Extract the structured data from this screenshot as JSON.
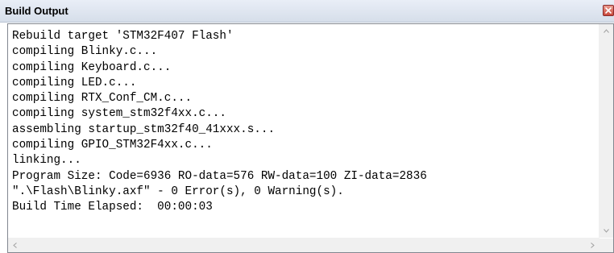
{
  "window": {
    "title": "Build Output",
    "close_icon": "close-icon"
  },
  "log": {
    "lines": [
      "Rebuild target 'STM32F407 Flash'",
      "compiling Blinky.c...",
      "compiling Keyboard.c...",
      "compiling LED.c...",
      "compiling RTX_Conf_CM.c...",
      "compiling system_stm32f4xx.c...",
      "assembling startup_stm32f40_41xxx.s...",
      "compiling GPIO_STM32F4xx.c...",
      "linking...",
      "Program Size: Code=6936 RO-data=576 RW-data=100 ZI-data=2836",
      "\".\\Flash\\Blinky.axf\" - 0 Error(s), 0 Warning(s).",
      "Build Time Elapsed:  00:00:03"
    ]
  },
  "scrollbars": {
    "up_icon": "chevron-up-icon",
    "down_icon": "chevron-down-icon",
    "left_icon": "chevron-left-icon",
    "right_icon": "chevron-right-icon"
  },
  "colors": {
    "title_bar": "#dbe2ed",
    "close_button": "#d35a4a",
    "text": "#000000"
  }
}
